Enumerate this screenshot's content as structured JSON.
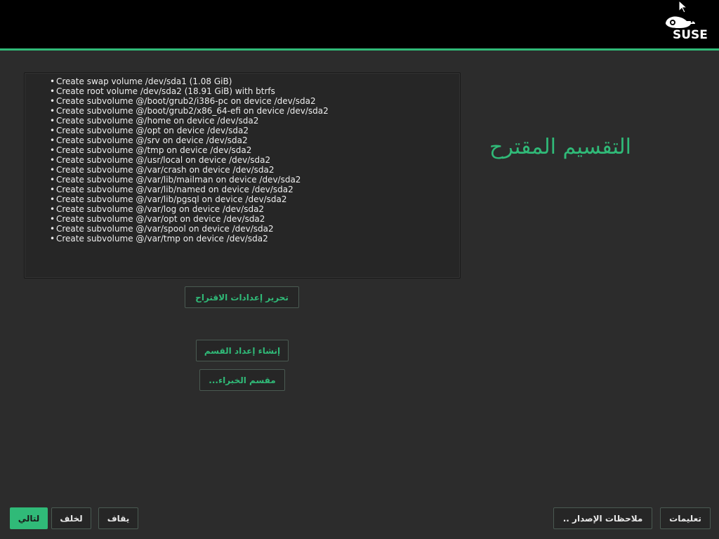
{
  "header": {
    "logo_text": "SUSE"
  },
  "proposal": {
    "items": [
      "Create swap volume /dev/sda1 (1.08 GiB)",
      "Create root volume /dev/sda2 (18.91 GiB) with btrfs",
      "Create subvolume @/boot/grub2/i386-pc on device /dev/sda2",
      "Create subvolume @/boot/grub2/x86_64-efi on device /dev/sda2",
      "Create subvolume @/home on device /dev/sda2",
      "Create subvolume @/opt on device /dev/sda2",
      "Create subvolume @/srv on device /dev/sda2",
      "Create subvolume @/tmp on device /dev/sda2",
      "Create subvolume @/usr/local on device /dev/sda2",
      "Create subvolume @/var/crash on device /dev/sda2",
      "Create subvolume @/var/lib/mailman on device /dev/sda2",
      "Create subvolume @/var/lib/named on device /dev/sda2",
      "Create subvolume @/var/lib/pgsql on device /dev/sda2",
      "Create subvolume @/var/log on device /dev/sda2",
      "Create subvolume @/var/opt on device /dev/sda2",
      "Create subvolume @/var/spool on device /dev/sda2",
      "Create subvolume @/var/tmp on device /dev/sda2"
    ]
  },
  "title": "التقسيم المقترح",
  "buttons": {
    "edit_proposal": "تحرير إعدادات الاقتراح",
    "create_partition_setup": "إنشاء إعداد القسم",
    "expert_partitioner": "مقسم الخبراء...",
    "next": "لتالي",
    "back": "لخلف",
    "abort": "يقاف",
    "release_notes": "ملاحظات الإصدار ..",
    "help": "تعليمات"
  },
  "colors": {
    "accent": "#30ba78",
    "background": "#2c2c2c",
    "header": "#000000"
  }
}
